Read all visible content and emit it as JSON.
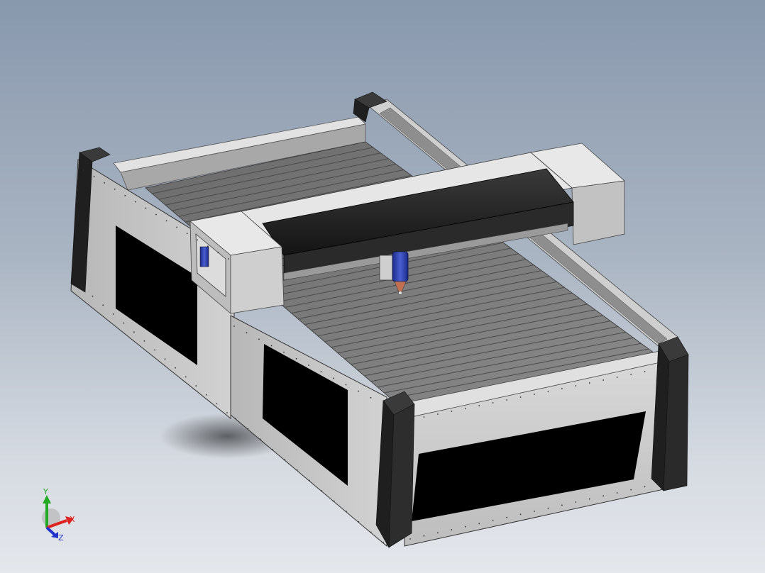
{
  "viewport": {
    "background_top": "#8898ad",
    "background_bottom": "#e4e7ec"
  },
  "model": {
    "frame_color": "#c9c9c9",
    "panel_color": "#000000",
    "corner_cap_color": "#2a2a2a",
    "gantry_beam_color": "#1e1e1e",
    "laser_head_color": "#2233aa"
  },
  "triad": {
    "x_label": "X",
    "y_label": "Y",
    "z_label": "Z",
    "x_color": "#dd2222",
    "y_color": "#22aa22",
    "z_color": "#2233cc"
  }
}
